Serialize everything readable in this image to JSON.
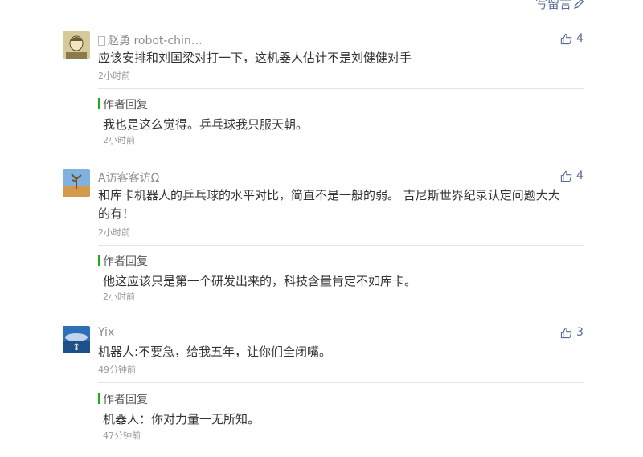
{
  "header": {
    "write_label": "写留言"
  },
  "comments": [
    {
      "nickname": "赵勇 robot-chin…",
      "likes": "4",
      "content": "应该安排和刘国梁对打一下，这机器人估计不是刘健健对手",
      "time": "2小时前",
      "reply": {
        "label": "作者回复",
        "content": "我也是这么觉得。乒乓球我只服天朝。",
        "time": "2小时前"
      }
    },
    {
      "nickname": "A访客客访Ω",
      "likes": "4",
      "content_lines": [
        "和库卡机器人的乒乓球的水平对比，简直不是一般的弱。 吉尼斯世界纪录认定问题大大",
        "的有！"
      ],
      "time": "2小时前",
      "reply": {
        "label": "作者回复",
        "content": "他这应该只是第一个研发出来的，科技含量肯定不如库卡。",
        "time": "2小时前"
      }
    },
    {
      "nickname": "Yix",
      "likes": "3",
      "content": "机器人:不要急，给我五年，让你们全闭嘴。",
      "time": "49分钟前",
      "reply": {
        "label": "作者回复",
        "content": "机器人：你对力量一无所知。",
        "time": "47分钟前"
      }
    }
  ]
}
